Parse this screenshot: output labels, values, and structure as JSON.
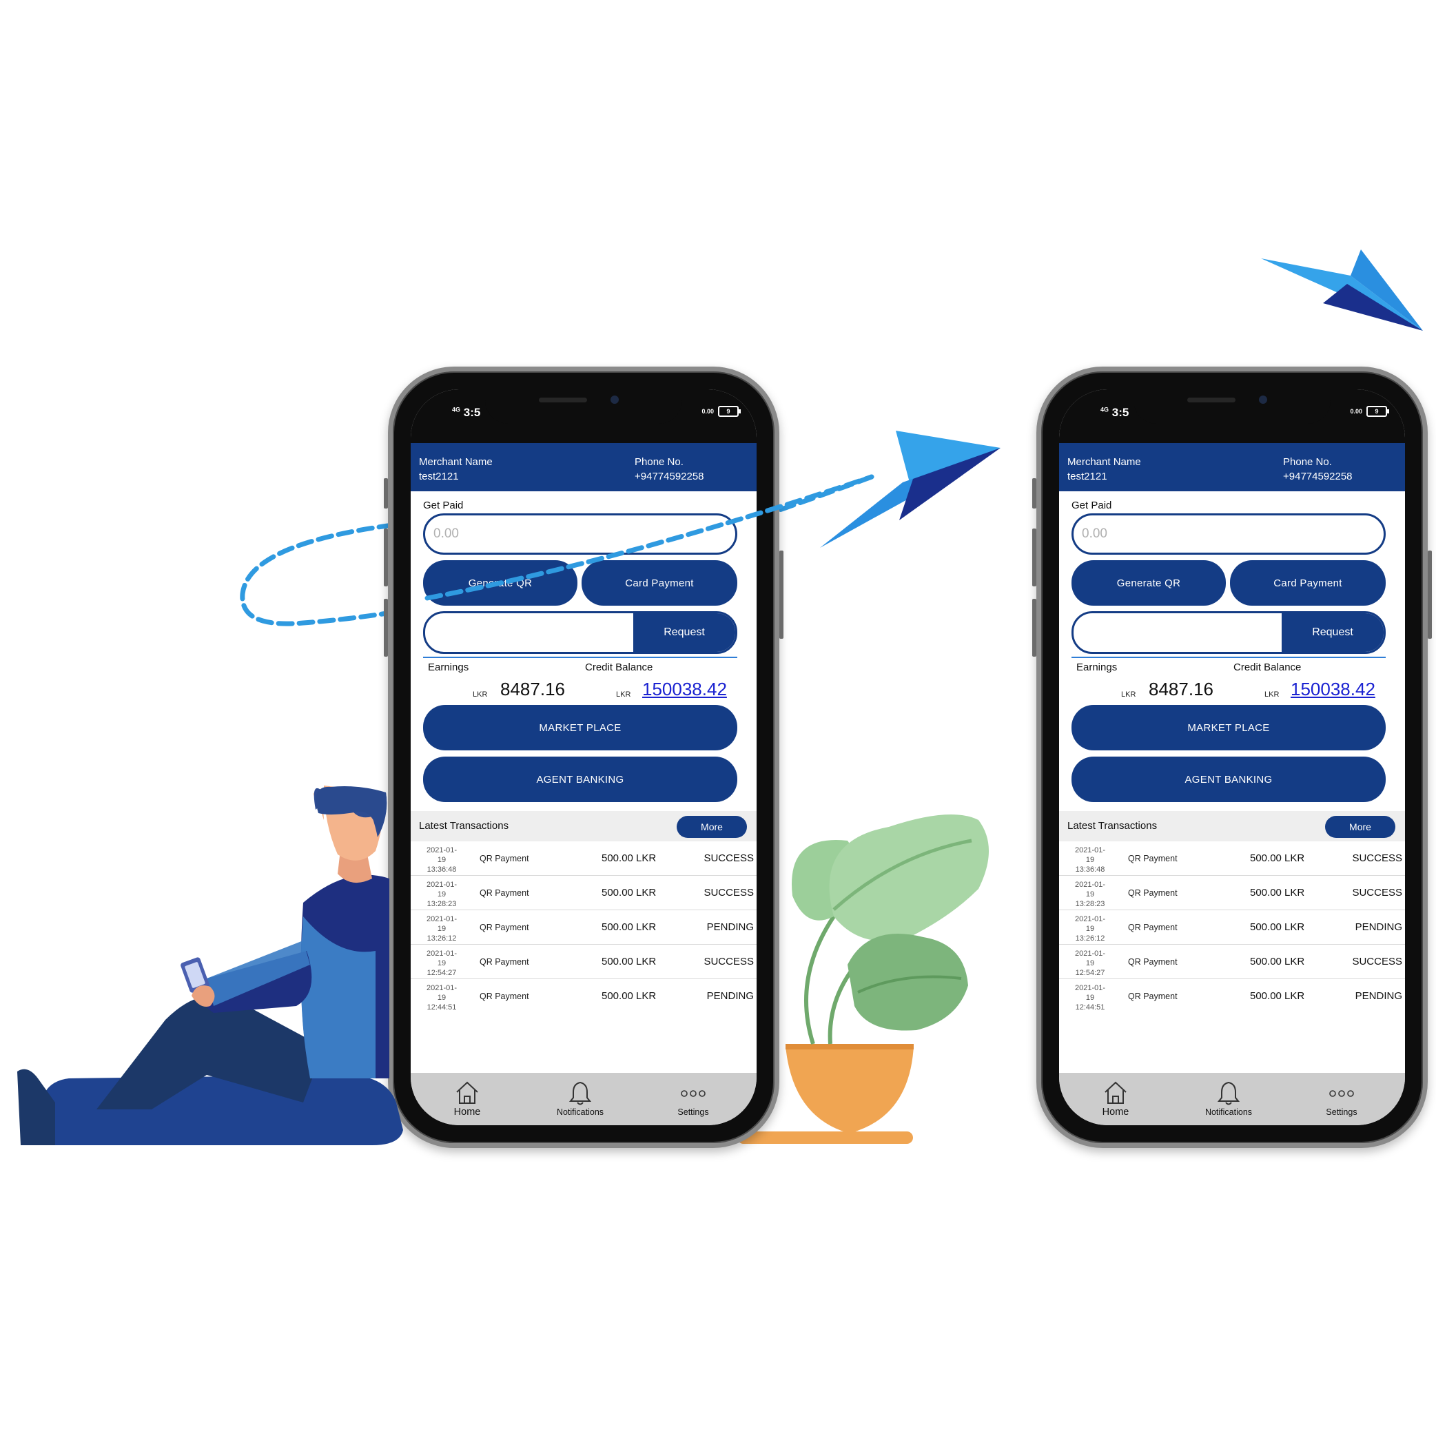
{
  "phones": [
    {
      "status": {
        "network": "4G",
        "time": "3:5",
        "speed": "0.00",
        "speed_unit": "KB/s",
        "battery": "9"
      },
      "header": {
        "merchant_label": "Merchant Name",
        "merchant_value": "test2121",
        "phone_label": "Phone No.",
        "phone_value": "+94774592258"
      },
      "get_paid": {
        "label": "Get Paid",
        "placeholder": "0.00"
      },
      "buttons": {
        "generate_qr": "Generate QR",
        "card_payment": "Card Payment",
        "request": "Request",
        "market_place": "MARKET PLACE",
        "agent_banking": "AGENT BANKING"
      },
      "balances": {
        "earnings_label": "Earnings",
        "earnings_currency": "LKR",
        "earnings_value": "8487.16",
        "credit_label": "Credit Balance",
        "credit_currency": "LKR",
        "credit_value": "150038.42"
      },
      "transactions": {
        "title": "Latest Transactions",
        "more": "More",
        "rows": [
          {
            "date": "2021-01-19",
            "time": "13:36:48",
            "type": "QR Payment",
            "amount": "500.00 LKR",
            "status": "SUCCESS"
          },
          {
            "date": "2021-01-19",
            "time": "13:28:23",
            "type": "QR Payment",
            "amount": "500.00 LKR",
            "status": "SUCCESS"
          },
          {
            "date": "2021-01-19",
            "time": "13:26:12",
            "type": "QR Payment",
            "amount": "500.00 LKR",
            "status": "PENDING"
          },
          {
            "date": "2021-01-19",
            "time": "12:54:27",
            "type": "QR Payment",
            "amount": "500.00 LKR",
            "status": "SUCCESS"
          },
          {
            "date": "2021-01-19",
            "time": "12:44:51",
            "type": "QR Payment",
            "amount": "500.00 LKR",
            "status": "PENDING"
          }
        ]
      },
      "tabs": {
        "home": "Home",
        "notifications": "Notifications",
        "settings": "Settings"
      }
    },
    {
      "status": {
        "network": "4G",
        "time": "3:5",
        "speed": "0.00",
        "speed_unit": "KB/s",
        "battery": "9"
      },
      "header": {
        "merchant_label": "Merchant Name",
        "merchant_value": "test2121",
        "phone_label": "Phone No.",
        "phone_value": "+94774592258"
      },
      "get_paid": {
        "label": "Get Paid",
        "placeholder": "0.00"
      },
      "buttons": {
        "generate_qr": "Generate QR",
        "card_payment": "Card Payment",
        "request": "Request",
        "market_place": "MARKET PLACE",
        "agent_banking": "AGENT BANKING"
      },
      "balances": {
        "earnings_label": "Earnings",
        "earnings_currency": "LKR",
        "earnings_value": "8487.16",
        "credit_label": "Credit Balance",
        "credit_currency": "LKR",
        "credit_value": "150038.42"
      },
      "transactions": {
        "title": "Latest Transactions",
        "more": "More",
        "rows": [
          {
            "date": "2021-01-19",
            "time": "13:36:48",
            "type": "QR Payment",
            "amount": "500.00 LKR",
            "status": "SUCCESS"
          },
          {
            "date": "2021-01-19",
            "time": "13:28:23",
            "type": "QR Payment",
            "amount": "500.00 LKR",
            "status": "SUCCESS"
          },
          {
            "date": "2021-01-19",
            "time": "13:26:12",
            "type": "QR Payment",
            "amount": "500.00 LKR",
            "status": "PENDING"
          },
          {
            "date": "2021-01-19",
            "time": "12:54:27",
            "type": "QR Payment",
            "amount": "500.00 LKR",
            "status": "SUCCESS"
          },
          {
            "date": "2021-01-19",
            "time": "12:44:51",
            "type": "QR Payment",
            "amount": "500.00 LKR",
            "status": "PENDING"
          }
        ]
      },
      "tabs": {
        "home": "Home",
        "notifications": "Notifications",
        "settings": "Settings"
      }
    }
  ],
  "colors": {
    "brand_navy": "#143c85",
    "accent_blue": "#2f7dd6",
    "plane_light": "#35a3ea",
    "plane_dark": "#1a2f8c",
    "plant_green": "#8cc891",
    "pot_orange": "#f0a552"
  },
  "illustration": {
    "icons": [
      "paper-plane-icon",
      "person-illustration",
      "plant-illustration",
      "dashed-flight-path"
    ]
  }
}
